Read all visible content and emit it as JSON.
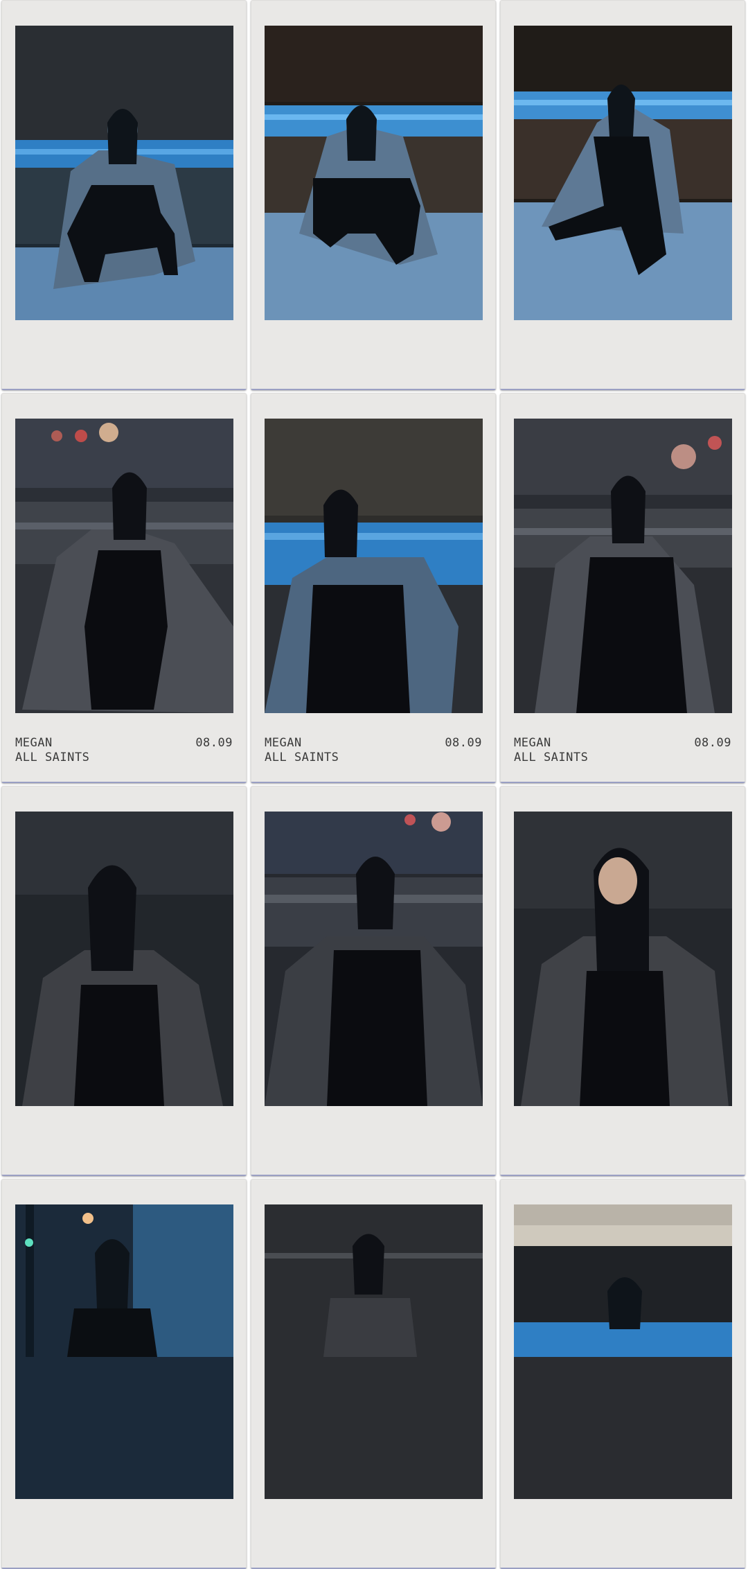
{
  "gallery": {
    "polaroids": [
      {
        "id": "p1",
        "tone": "blue",
        "pose": "crouch",
        "caption": null
      },
      {
        "id": "p2",
        "tone": "blue",
        "pose": "crouch",
        "caption": null
      },
      {
        "id": "p3",
        "tone": "blue",
        "pose": "kneel",
        "caption": null
      },
      {
        "id": "p4",
        "tone": "dusk",
        "pose": "seated",
        "caption": {
          "name": "MEGAN",
          "date": "08.09",
          "brand": "ALL SAINTS"
        }
      },
      {
        "id": "p5",
        "tone": "blue",
        "pose": "seated",
        "caption": {
          "name": "MEGAN",
          "date": "08.09",
          "brand": "ALL SAINTS"
        }
      },
      {
        "id": "p6",
        "tone": "dusk",
        "pose": "seated",
        "caption": {
          "name": "MEGAN",
          "date": "08.09",
          "brand": "ALL SAINTS"
        }
      },
      {
        "id": "p7",
        "tone": "dark",
        "pose": "portrait",
        "caption": null
      },
      {
        "id": "p8",
        "tone": "dark",
        "pose": "seated",
        "caption": null
      },
      {
        "id": "p9",
        "tone": "dark",
        "pose": "portrait",
        "caption": null
      },
      {
        "id": "p10",
        "tone": "blue",
        "pose": "portrait",
        "caption": null
      },
      {
        "id": "p11",
        "tone": "dark",
        "pose": "portrait",
        "caption": null
      },
      {
        "id": "p12",
        "tone": "sky",
        "pose": "portrait",
        "caption": null
      }
    ]
  },
  "colors": {
    "frame": "#e9e8e6",
    "caption_text": "#3a3a3a",
    "rail_blue": "#2f7fc4",
    "night_blue": "#1b2a3a"
  }
}
